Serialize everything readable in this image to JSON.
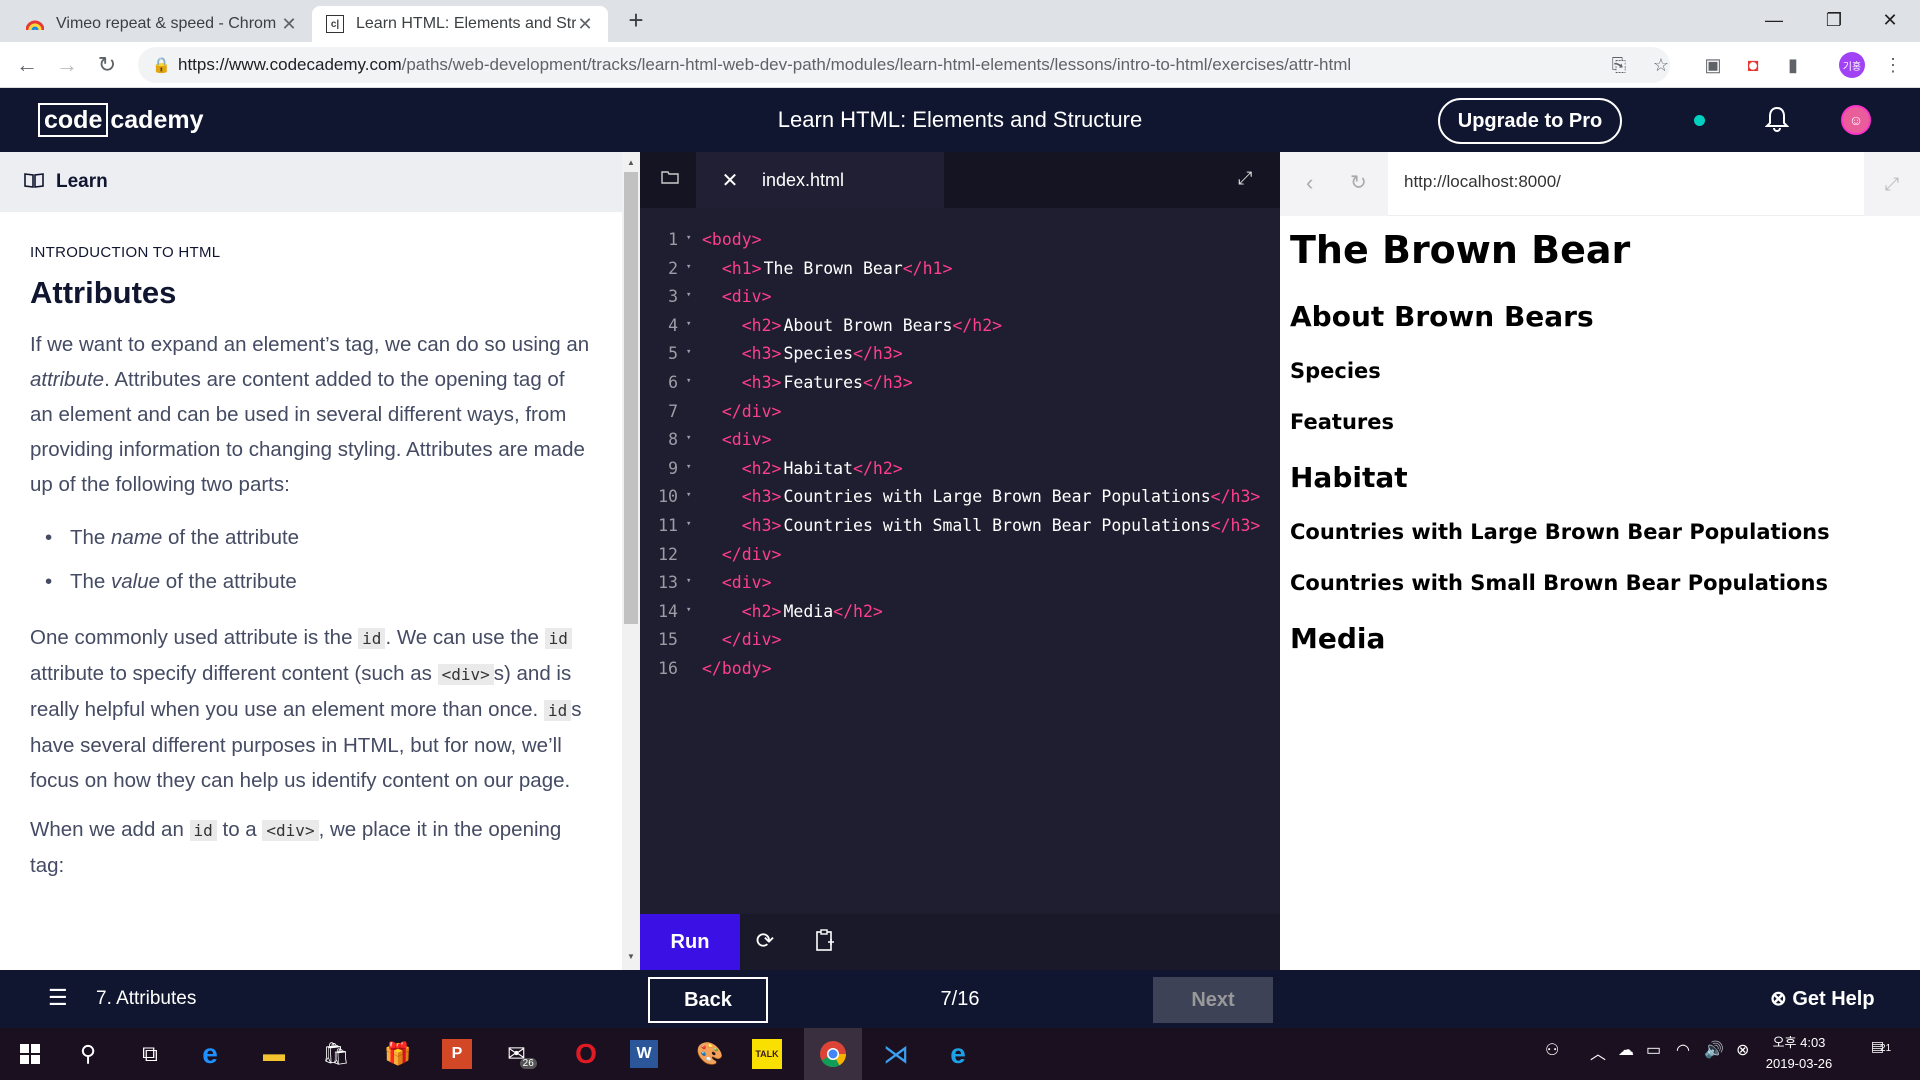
{
  "chrome": {
    "tabs": [
      {
        "title": "Vimeo repeat & speed - Chrom",
        "icon": "rainbow-icon"
      },
      {
        "title": "Learn HTML: Elements and Stru",
        "icon": "codecademy-icon"
      }
    ],
    "url_host": "https://www.codecademy.com",
    "url_path": "/paths/web-development/tracks/learn-html-web-dev-path/modules/learn-html-elements/lessons/intro-to-html/exercises/attr-html",
    "profile_label": "기홍"
  },
  "header": {
    "logo_box": "code",
    "logo_rest": "cademy",
    "title": "Learn HTML: Elements and Structure",
    "upgrade_label": "Upgrade to Pro"
  },
  "learn": {
    "tab_label": "Learn",
    "eyebrow": "INTRODUCTION TO HTML",
    "heading": "Attributes",
    "p1_a": "If we want to expand an element’s tag, we can do so using an ",
    "p1_em": "attribute",
    "p1_b": ". Attributes are content added to the opening tag of an element and can be used in several different ways, from providing information to changing styling. Attributes are made up of the following two parts:",
    "bullet1_a": "The ",
    "bullet1_em": "name",
    "bullet1_b": " of the attribute",
    "bullet2_a": "The ",
    "bullet2_em": "value",
    "bullet2_b": " of the attribute",
    "p2_a": "One commonly used attribute is the ",
    "p2_code1": "id",
    "p2_b": ". We can use the ",
    "p2_code2": "id",
    "p2_c": " attribute to specify different content (such as ",
    "p2_code3": "<div>",
    "p2_d": "s) and is really helpful when you use an element more than once. ",
    "p2_code4": "id",
    "p2_e": "s have several different purposes in HTML, but for now, we’ll focus on how they can help us identify content on our page.",
    "p3_a": "When we add an ",
    "p3_code1": "id",
    "p3_b": " to a ",
    "p3_code2": "<div>",
    "p3_c": ", we place it in the opening tag:"
  },
  "editor": {
    "file_name": "index.html",
    "lines": [
      {
        "n": "1",
        "fold": "▾",
        "indent": "",
        "open": "<body>",
        "text": "",
        "close": ""
      },
      {
        "n": "2",
        "fold": "▾",
        "indent": "  ",
        "open": "<h1>",
        "text": "The Brown Bear",
        "close": "</h1>"
      },
      {
        "n": "3",
        "fold": "▾",
        "indent": "  ",
        "open": "<div>",
        "text": "",
        "close": ""
      },
      {
        "n": "4",
        "fold": "▾",
        "indent": "    ",
        "open": "<h2>",
        "text": "About Brown Bears",
        "close": "</h2>"
      },
      {
        "n": "5",
        "fold": "▾",
        "indent": "    ",
        "open": "<h3>",
        "text": "Species",
        "close": "</h3>"
      },
      {
        "n": "6",
        "fold": "▾",
        "indent": "    ",
        "open": "<h3>",
        "text": "Features",
        "close": "</h3>"
      },
      {
        "n": "7",
        "fold": "",
        "indent": "  ",
        "open": "</div>",
        "text": "",
        "close": ""
      },
      {
        "n": "8",
        "fold": "▾",
        "indent": "  ",
        "open": "<div>",
        "text": "",
        "close": ""
      },
      {
        "n": "9",
        "fold": "▾",
        "indent": "    ",
        "open": "<h2>",
        "text": "Habitat",
        "close": "</h2>"
      },
      {
        "n": "10",
        "fold": "▾",
        "indent": "    ",
        "open": "<h3>",
        "text": "Countries with Large Brown Bear Populations",
        "close": "</h3>"
      },
      {
        "n": "11",
        "fold": "▾",
        "indent": "    ",
        "open": "<h3>",
        "text": "Countries with Small Brown Bear Populations",
        "close": "</h3>"
      },
      {
        "n": "12",
        "fold": "",
        "indent": "  ",
        "open": "</div>",
        "text": "",
        "close": ""
      },
      {
        "n": "13",
        "fold": "▾",
        "indent": "  ",
        "open": "<div>",
        "text": "",
        "close": ""
      },
      {
        "n": "14",
        "fold": "▾",
        "indent": "    ",
        "open": "<h2>",
        "text": "Media",
        "close": "</h2>"
      },
      {
        "n": "15",
        "fold": "",
        "indent": "  ",
        "open": "</div>",
        "text": "",
        "close": ""
      },
      {
        "n": "16",
        "fold": "",
        "indent": "",
        "open": "</body>",
        "text": "",
        "close": ""
      }
    ],
    "run_label": "Run"
  },
  "preview": {
    "url": "http://localhost:8000/",
    "h1": "The Brown Bear",
    "h2_about": "About Brown Bears",
    "h3_species": "Species",
    "h3_features": "Features",
    "h2_habitat": "Habitat",
    "h3_large": "Countries with Large Brown Bear Populations",
    "h3_small": "Countries with Small Brown Bear Populations",
    "h2_media": "Media"
  },
  "footer": {
    "lesson": "7. Attributes",
    "back_label": "Back",
    "progress": "7/16",
    "next_label": "Next",
    "help_label": "Get Help"
  },
  "taskbar": {
    "mail_badge": "26",
    "clock_time": "오후 4:03",
    "clock_date": "2019-03-26",
    "notif_count": "21"
  },
  "colors": {
    "codecademy_navy": "#10162f",
    "run_button": "#3a10e5",
    "code_tag": "#ff3e8d",
    "status_dot": "#00d1c1"
  }
}
